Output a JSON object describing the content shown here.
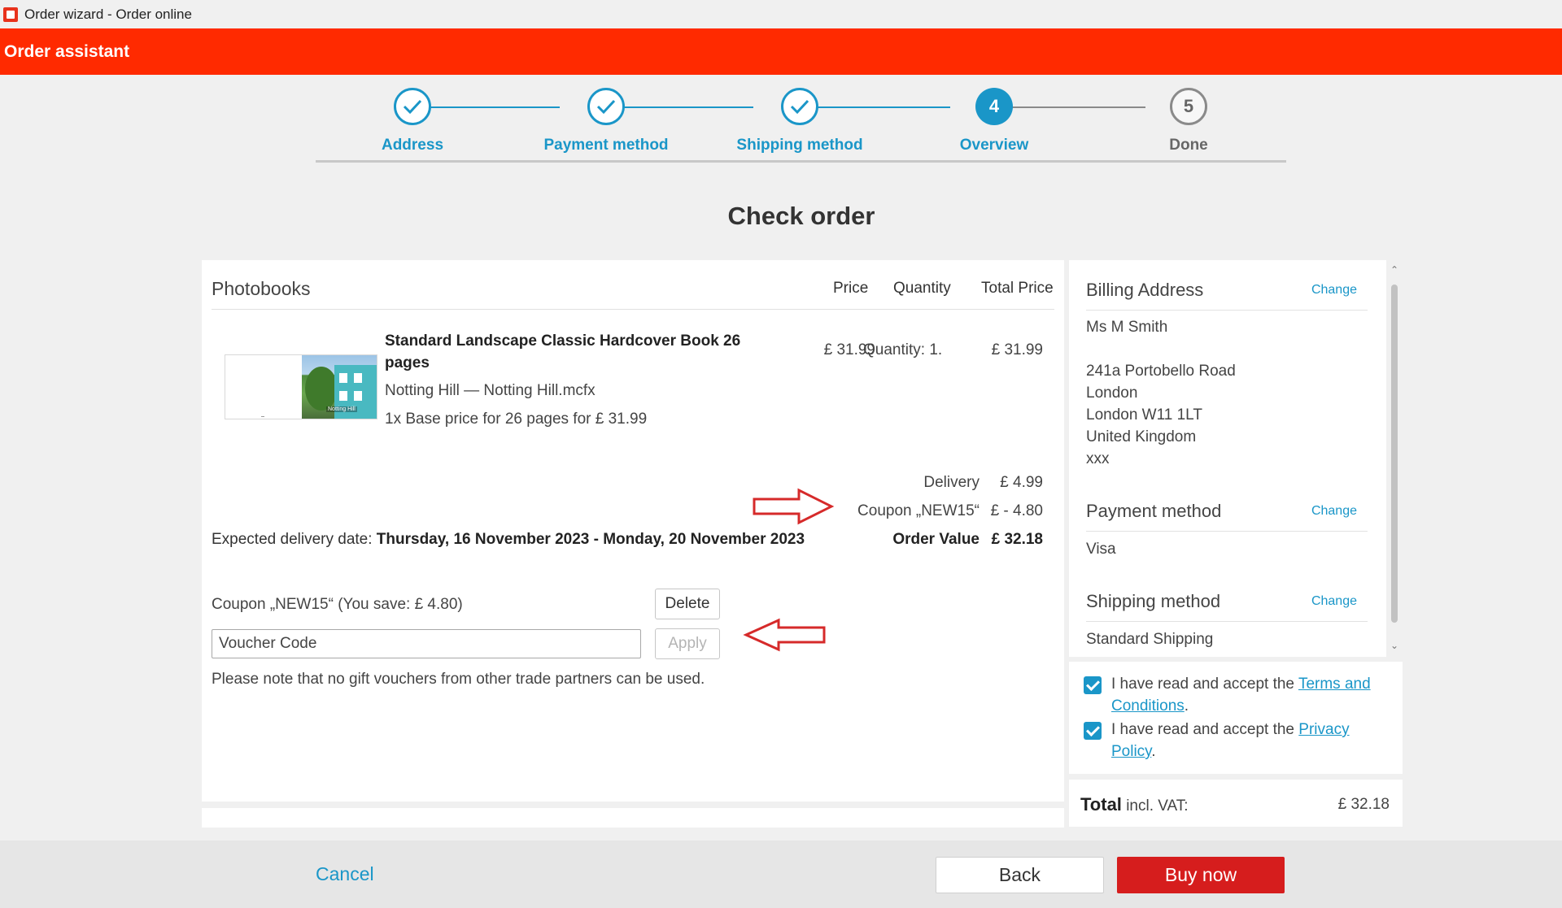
{
  "window": {
    "title": "Order wizard - Order online",
    "icon": "app-icon"
  },
  "header": {
    "app_name": "Order assistant",
    "brand_color": "#ff2a00"
  },
  "stepper": {
    "steps": [
      {
        "number": "",
        "label": "Address",
        "state": "done"
      },
      {
        "number": "",
        "label": "Payment method",
        "state": "done"
      },
      {
        "number": "",
        "label": "Shipping method",
        "state": "done"
      },
      {
        "number": "4",
        "label": "Overview",
        "state": "active"
      },
      {
        "number": "5",
        "label": "Done",
        "state": "todo"
      }
    ],
    "accent_color": "#1a96c8"
  },
  "page": {
    "title": "Check order"
  },
  "order": {
    "section_title": "Photobooks",
    "columns": {
      "price": "Price",
      "quantity": "Quantity",
      "total": "Total Price"
    },
    "product": {
      "name": "Standard Landscape Classic Hardcover Book 26 pages",
      "file": "Notting Hill — Notting Hill.mcfx",
      "base_price": "1x Base price for 26 pages for £ 31.99",
      "price": "£ 31.99",
      "quantity": "Quantity: 1.",
      "total": "£ 31.99",
      "thumbnail_caption": "Notting Hill"
    },
    "summary": {
      "delivery_label": "Delivery",
      "delivery_value": "£ 4.99",
      "coupon_label": "Coupon „NEW15“",
      "coupon_value": "£ - 4.80",
      "order_value_label": "Order Value",
      "order_value": "£ 32.18"
    },
    "delivery_label": "Expected delivery date:",
    "delivery_dates": "Thursday, 16 November 2023 - Monday, 20 November 2023",
    "coupon_info": "Coupon „NEW15“ (You save: £ 4.80)",
    "delete_label": "Delete",
    "voucher_placeholder": "Voucher Code",
    "apply_label": "Apply",
    "note": "Please note that no gift vouchers from other trade partners can be used."
  },
  "sidebar": {
    "billing": {
      "title": "Billing Address",
      "change": "Change",
      "name": "Ms M Smith",
      "street": "241a Portobello Road",
      "city": "London",
      "postcode": "London W11 1LT",
      "country": "United Kingdom",
      "extra": "xxx"
    },
    "payment": {
      "title": "Payment method",
      "change": "Change",
      "value": "Visa"
    },
    "shipping": {
      "title": "Shipping method",
      "change": "Change",
      "value": "Standard Shipping"
    }
  },
  "terms": {
    "prefix": "I have read and accept the",
    "terms_link": "Terms and Conditions",
    "privacy_link": "Privacy Policy",
    "suffix": ".",
    "terms_checked": true,
    "privacy_checked": true
  },
  "total": {
    "label": "Total",
    "suffix": "incl. VAT:",
    "value": "£ 32.18"
  },
  "footer": {
    "cancel": "Cancel",
    "back": "Back",
    "buy": "Buy now",
    "buy_color": "#d61d1d"
  },
  "annotations": {
    "arrow_color": "#d62a2a"
  }
}
